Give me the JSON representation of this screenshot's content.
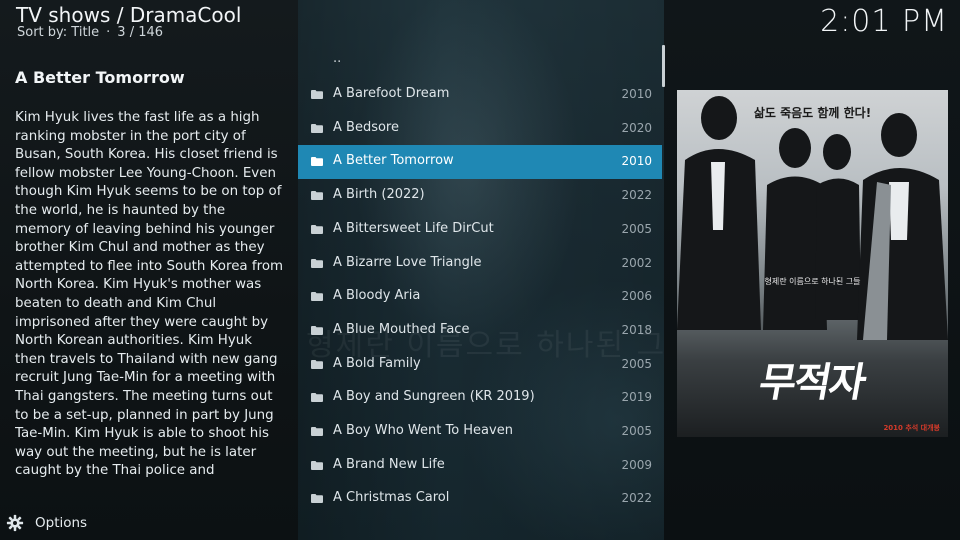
{
  "header": {
    "title": "TV shows / DramaCool",
    "sort_label": "Sort by: Title",
    "position": "3 / 146",
    "separator": "·"
  },
  "clock": "2:01 PM",
  "plot": {
    "title": "A Better Tomorrow",
    "text": "Kim Hyuk lives the fast life as a high ranking mobster in the port city of Busan, South Korea. His closet friend is fellow mobster Lee Young-Choon. Even though Kim Hyuk seems to be on top of the world, he is haunted by the memory of leaving behind his younger brother Kim Chul and mother as they attempted to flee into South Korea from North Korea. Kim Hyuk's mother was beaten to death and Kim Chul imprisoned after they were caught by North Korean authorities. Kim Hyuk then travels to Thailand with new gang recruit Jung Tae-Min for a meeting with Thai gangsters. The meeting turns out to be a set-up, planned in part by Jung Tae-Min. Kim Hyuk is able to shoot his way out the meeting, but he is later caught by the Thai police and"
  },
  "list": {
    "parent_label": "..",
    "items": [
      {
        "title": "A Barefoot Dream",
        "year": "2010"
      },
      {
        "title": "A Bedsore",
        "year": "2020"
      },
      {
        "title": "A Better Tomorrow",
        "year": "2010",
        "selected": true
      },
      {
        "title": "A Birth (2022)",
        "year": "2022"
      },
      {
        "title": "A Bittersweet Life DirCut",
        "year": "2005"
      },
      {
        "title": "A Bizarre Love Triangle",
        "year": "2002"
      },
      {
        "title": "A Bloody Aria",
        "year": "2006"
      },
      {
        "title": "A Blue Mouthed Face",
        "year": "2018"
      },
      {
        "title": "A Bold Family",
        "year": "2005"
      },
      {
        "title": "A Boy and Sungreen (KR 2019)",
        "year": "2019"
      },
      {
        "title": "A Boy Who Went To Heaven",
        "year": "2005"
      },
      {
        "title": "A Brand New Life",
        "year": "2009"
      },
      {
        "title": "A Christmas Carol",
        "year": "2022"
      }
    ]
  },
  "poster": {
    "tagline": "삶도 죽음도 함께 한다!",
    "subline": "형제란 이름으로 하나된 그들",
    "small_top": "강한 액션 블록버스터",
    "big_title": "무적자",
    "date": "2010 추석 대개봉"
  },
  "options": {
    "label": "Options"
  },
  "colors": {
    "selection": "#1f88b4",
    "background": "#0c1418"
  },
  "icons": {
    "folder": "folder-icon",
    "options": "gear-icon"
  }
}
